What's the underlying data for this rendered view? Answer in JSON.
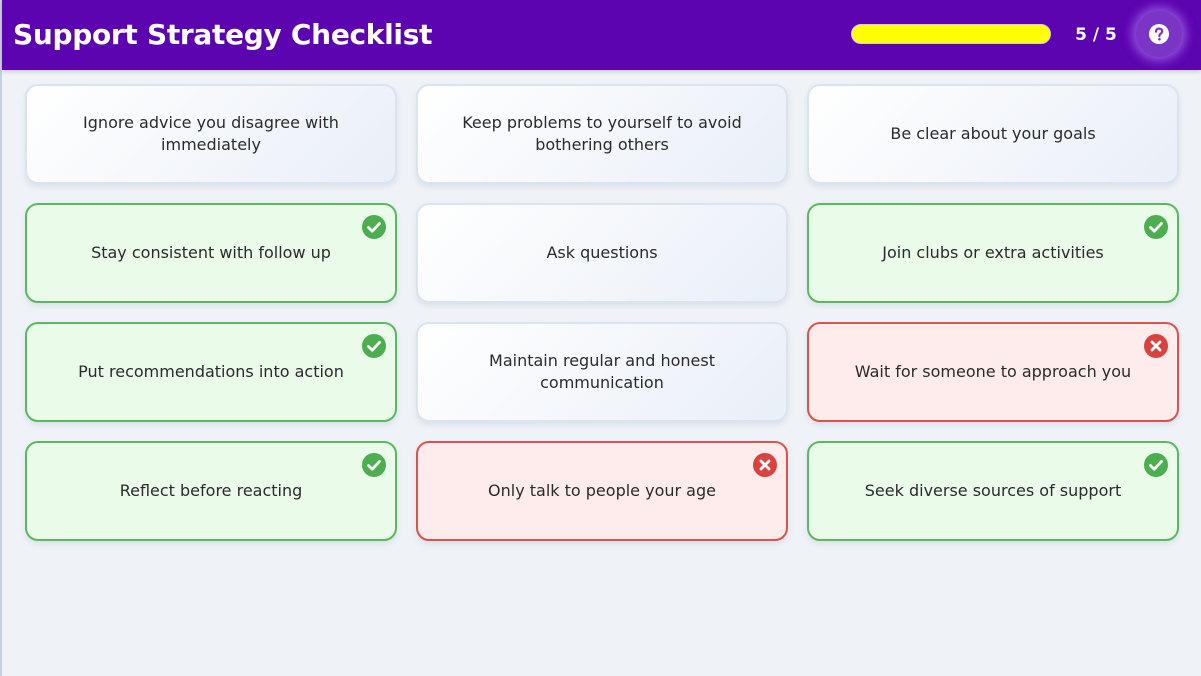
{
  "header": {
    "title": "Support Strategy Checklist",
    "progress_fraction": 1.0,
    "progress_text": "5 / 5",
    "accent_color": "#5c04b0",
    "progress_color": "#ffff00",
    "help_icon": "question-circle-icon"
  },
  "cards": [
    {
      "label": "Ignore advice you disagree with immediately",
      "state": "neutral"
    },
    {
      "label": "Keep problems to yourself to avoid bothering others",
      "state": "neutral"
    },
    {
      "label": "Be clear about your goals",
      "state": "neutral"
    },
    {
      "label": "Stay consistent with follow up",
      "state": "correct"
    },
    {
      "label": "Ask questions",
      "state": "neutral"
    },
    {
      "label": "Join clubs or extra activities",
      "state": "correct"
    },
    {
      "label": "Put recommendations into action",
      "state": "correct"
    },
    {
      "label": "Maintain regular and honest communication",
      "state": "neutral"
    },
    {
      "label": "Wait for someone to approach you",
      "state": "wrong"
    },
    {
      "label": "Reflect before reacting",
      "state": "correct"
    },
    {
      "label": "Only talk to people your age",
      "state": "wrong"
    },
    {
      "label": "Seek diverse sources of support",
      "state": "correct"
    }
  ],
  "status_colors": {
    "correct": "#4cae50",
    "wrong": "#d9433f"
  }
}
